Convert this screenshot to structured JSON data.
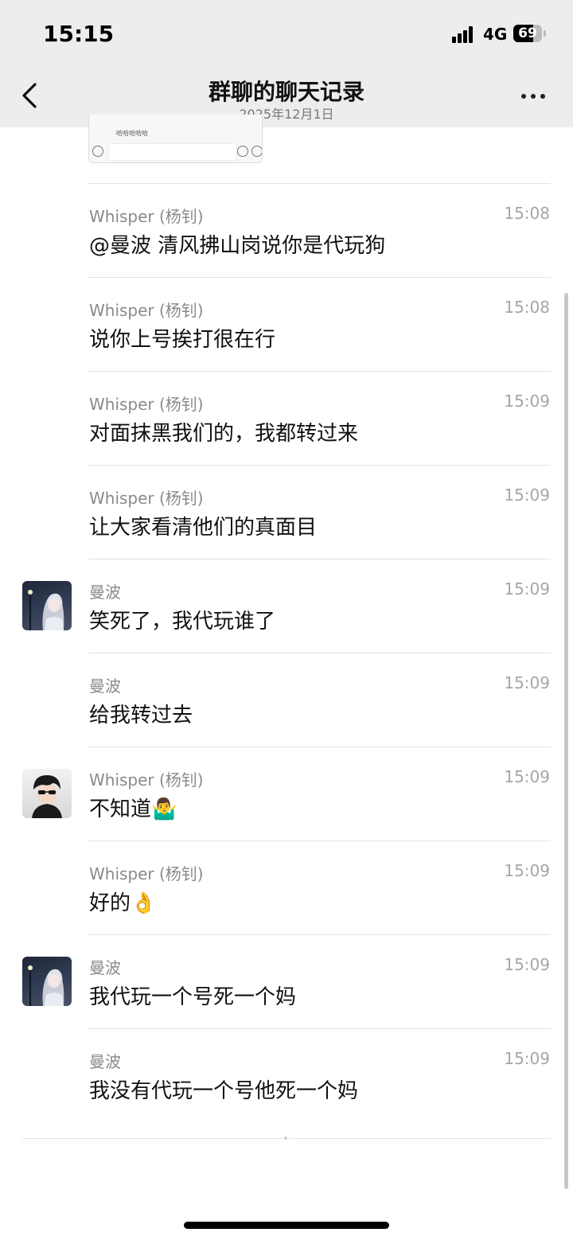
{
  "status_bar": {
    "time": "15:15",
    "network": "4G",
    "battery": "69",
    "battery_level": 0.69,
    "signal_icon": "cellular-signal-icon",
    "battery_icon": "battery-icon"
  },
  "nav": {
    "title": "群聊的聊天记录",
    "subtitle": "2025年12月1日",
    "back_icon": "chevron-left-icon",
    "more_icon": "more-dots-icon"
  },
  "quoted_card": {
    "thumb_text": "哈哈哈哈哈"
  },
  "messages": [
    {
      "sender": "Whisper (杨钊)",
      "time": "15:08",
      "text": "@曼波 清风拂山岗说你是代玩狗",
      "avatar": ""
    },
    {
      "sender": "Whisper (杨钊)",
      "time": "15:08",
      "text": "说你上号挨打很在行",
      "avatar": ""
    },
    {
      "sender": "Whisper (杨钊)",
      "time": "15:09",
      "text": "对面抹黑我们的，我都转过来",
      "avatar": ""
    },
    {
      "sender": "Whisper (杨钊)",
      "time": "15:09",
      "text": "让大家看清他们的真面目",
      "avatar": ""
    },
    {
      "sender": "曼波",
      "time": "15:09",
      "text": "笑死了，我代玩谁了",
      "avatar": "anime-girl-avatar"
    },
    {
      "sender": "曼波",
      "time": "15:09",
      "text": "给我转过去",
      "avatar": ""
    },
    {
      "sender": "Whisper (杨钊)",
      "time": "15:09",
      "text": "不知道🤷‍♂️",
      "avatar": "anime-boy-sunglasses-avatar"
    },
    {
      "sender": "Whisper (杨钊)",
      "time": "15:09",
      "text": "好的👌",
      "avatar": ""
    },
    {
      "sender": "曼波",
      "time": "15:09",
      "text": "我代玩一个号死一个妈",
      "avatar": "anime-girl-avatar"
    },
    {
      "sender": "曼波",
      "time": "15:09",
      "text": "我没有代玩一个号他死一个妈",
      "avatar": ""
    }
  ],
  "colors": {
    "header_bg": "#ededed",
    "sender_text": "#8a8a8a",
    "time_text": "#a6a6a6",
    "divider": "#e3e3e3"
  }
}
